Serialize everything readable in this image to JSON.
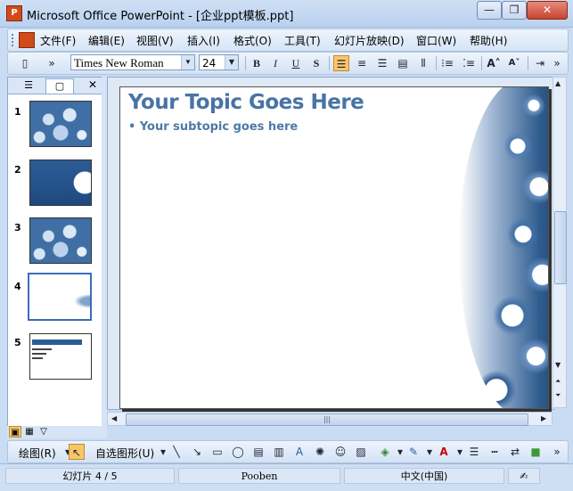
{
  "window": {
    "title": "Microsoft Office PowerPoint - [企业ppt模板.ppt]",
    "minimize": "—",
    "restore": "❐",
    "close": "✕"
  },
  "menubar": {
    "items": [
      "文件(F)",
      "编辑(E)",
      "视图(V)",
      "插入(I)",
      "格式(O)",
      "工具(T)",
      "幻灯片放映(D)",
      "窗口(W)",
      "帮助(H)"
    ]
  },
  "toolbar": {
    "font_name": "Times New Roman",
    "font_size": "24",
    "bold": "B",
    "italic": "I",
    "underline": "U",
    "shadow": "S"
  },
  "panel": {
    "tab_outline_icon": "outline-icon",
    "tab_slides_icon": "slides-icon",
    "close": "✕",
    "slides": [
      {
        "num": "1",
        "style": "blue"
      },
      {
        "num": "2",
        "style": "dark"
      },
      {
        "num": "3",
        "style": "blue"
      },
      {
        "num": "4",
        "style": "white"
      },
      {
        "num": "5",
        "style": "text"
      }
    ],
    "selected_slide": 4
  },
  "slide": {
    "title": "Your Topic Goes Here",
    "bullet": "•   Your subtopic goes here"
  },
  "drawbar": {
    "draw_label": "绘图(R)",
    "autoshapes_label": "自选图形(U)"
  },
  "status": {
    "slide_info": "幻灯片 4 / 5",
    "design": "Pooben",
    "language": "中文(中国)"
  },
  "colors": {
    "title_blue": "#4874a5",
    "chrome": "#c9dcf3"
  }
}
